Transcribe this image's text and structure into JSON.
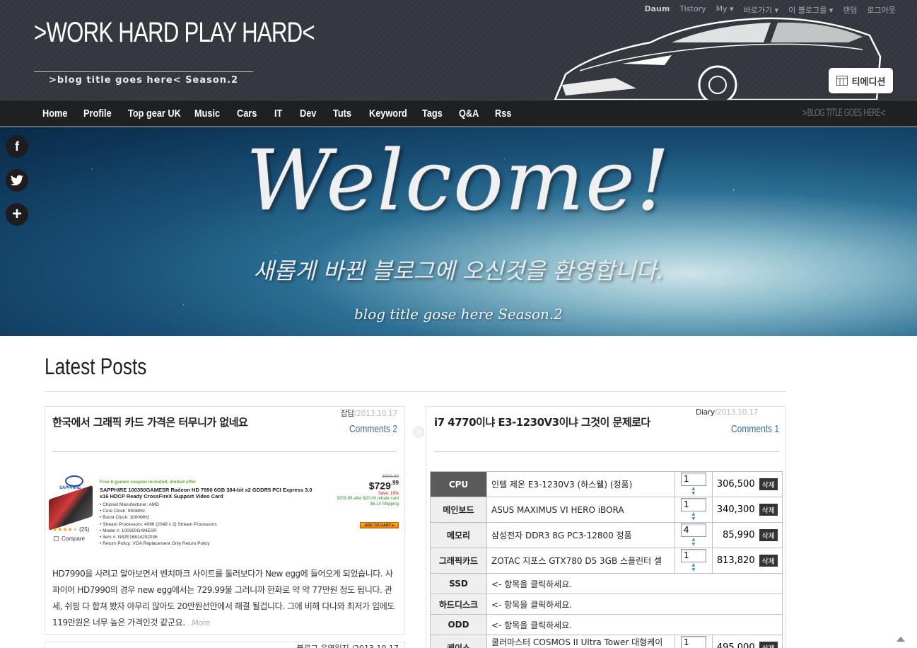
{
  "header": {
    "utility_links": [
      "Daum",
      "Tistory",
      "My ▾",
      "바로가기 ▾",
      "이 블로그를 ▾",
      "랜덤",
      "로그아웃"
    ],
    "logo": ">WORK HARD PLAY HARD<",
    "subtitle": ">blog title goes here< Season.2",
    "tedition_label": "티에디션"
  },
  "nav": {
    "items": [
      "Home",
      "Profile",
      "Top gear UK",
      "Music",
      "Cars",
      "IT",
      "Dev",
      "Tuts",
      "Keyword",
      "Tags",
      "Q&A",
      "Rss"
    ],
    "right_text": ">BLOG TITLE GOES HERE<"
  },
  "social": {
    "facebook": "f",
    "twitter": "t",
    "more": "+"
  },
  "banner": {
    "title": "Welcome!",
    "subtitle": "새롭게 바뀐 블로그에 오신것을 환영합니다.",
    "tagline": "blog title gose here Season.2"
  },
  "section_title": "Latest Posts",
  "posts": [
    {
      "category": "잡담",
      "date": "/2013.10.17",
      "title": "한국에서 그래픽 카드 가격은 터무니가 없네요",
      "comments": "Comments 2",
      "excerpt": "HD7990을 사려고 알아보면서 벤치마크 사이트를 둘러보다가 New egg에 들어오게 되었습니다. 사파이어 HD7990의 경우 new egg에서는 729.99불 그러니까 한화로 약 약 77만원 정도 됩니다. 관세, 쉬핑 다 합쳐 봤자 아무리 많아도 20만원선안에서 해결 될겁니다. 그에 비해 다나와 최저가 임에도 119만원은 너무 높은 가격인것 같군요.",
      "more": "..More",
      "product": {
        "brand": "SAPPHIRE",
        "promo": "Free 8 games coupon included, limited offer",
        "name": "SAPPHIRE 100350GAMESR Radeon HD 7990 6GB 384-bit x2 GDDR5 PCI Express 3.0 x16 HDCP Ready CrossFireX Support Video Card",
        "specs": [
          "• Chipset Manufacturer: AMD",
          "• Core Clock: 950MHz",
          "• Boost Clock: 1000MHz",
          "• Stream Processors: 4096 (2048 x 2) Stream Processors",
          "• Model #: 100350GAMESR",
          "• Item #: N82E16814202036",
          "• Return Policy: VGA Replacement Only Return Policy"
        ],
        "old_price": "$899.99",
        "price_main": "$729",
        "price_cents": ".99",
        "save": "Save: 19%",
        "after_rebate": "$709.99 after $20.00 rebate card",
        "shipping": "$6.14 Shipping",
        "rating_count": "(25)",
        "compare": "Compare",
        "add_to_cart": "ADD TO CART ▸"
      }
    },
    {
      "category": "Diary",
      "date": "/2013.10.17",
      "title": "i7 4770이냐 E3-1230V3이냐 그것이 문제로다",
      "comments": "Comments 1",
      "config_rows": [
        {
          "label": "CPU",
          "name": "인텔 제온 E3-1230V3 (하스웰) (정품)",
          "qty": "1",
          "price": "306,500",
          "del": "삭제",
          "highlight": true
        },
        {
          "label": "메인보드",
          "name": "ASUS MAXIMUS VI HERO iBORA",
          "qty": "1",
          "price": "340,300",
          "del": "삭제"
        },
        {
          "label": "메모리",
          "name": "삼성전자 DDR3 8G PC3-12800 정품",
          "qty": "4",
          "price": "85,990",
          "del": "삭제"
        },
        {
          "label": "그래픽카드",
          "name": "ZOTAC 지포스 GTX780 D5 3GB 스플린터 셀",
          "qty": "1",
          "price": "813,820",
          "del": "삭제"
        },
        {
          "label": "SSD",
          "name": "<- 항목을 클릭하세요."
        },
        {
          "label": "하드디스크",
          "name": "<- 항목을 클릭하세요."
        },
        {
          "label": "ODD",
          "name": "<- 항목을 클릭하세요."
        },
        {
          "label": "케이스",
          "name": "쿨러마스터 COSMOS II Ultra Tower 대형케이스",
          "qty": "1",
          "price": "495,000",
          "del": "삭제"
        }
      ]
    }
  ],
  "bottom_post_meta": "블로그 운영일지 /2013.10.17"
}
